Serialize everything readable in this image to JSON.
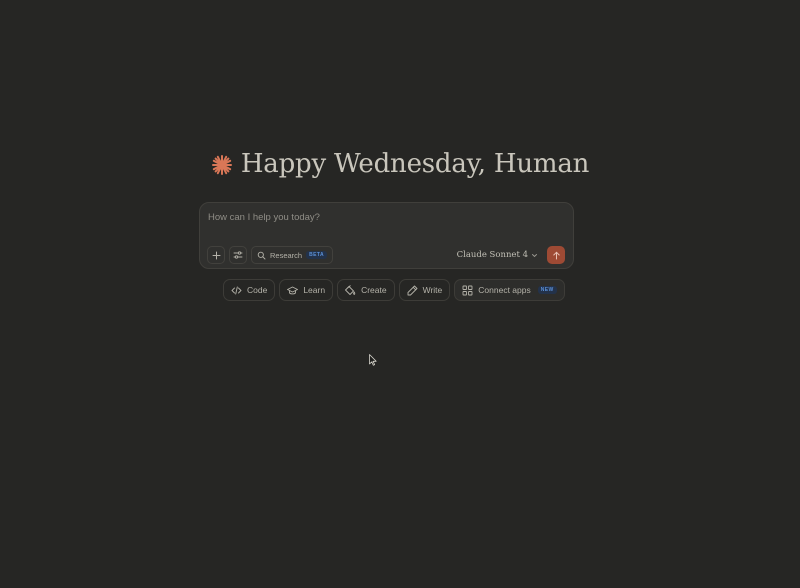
{
  "greeting": {
    "text": "Happy Wednesday, Human",
    "logo_icon": "claude-spark-icon",
    "logo_color": "#d97757"
  },
  "composer": {
    "placeholder": "How can I help you today?",
    "value": "",
    "add_icon": "plus-icon",
    "tools_icon": "sliders-icon",
    "research": {
      "label": "Research",
      "badge": "BETA",
      "icon": "search-icon"
    },
    "model": {
      "selected": "Claude Sonnet 4",
      "icon": "chevron-down-icon"
    },
    "send": {
      "icon": "arrow-up-icon",
      "color": "#9e4a34"
    }
  },
  "actions": [
    {
      "label": "Code",
      "icon": "code-icon"
    },
    {
      "label": "Learn",
      "icon": "graduation-cap-icon"
    },
    {
      "label": "Create",
      "icon": "paint-bucket-icon"
    },
    {
      "label": "Write",
      "icon": "pencil-icon"
    },
    {
      "label": "Connect apps",
      "icon": "grid-icon",
      "badge": "NEW"
    }
  ],
  "colors": {
    "background": "#262624",
    "composer_bg": "#30302e",
    "text": "#c2c0b6",
    "badge_text": "#5a8fd6"
  }
}
